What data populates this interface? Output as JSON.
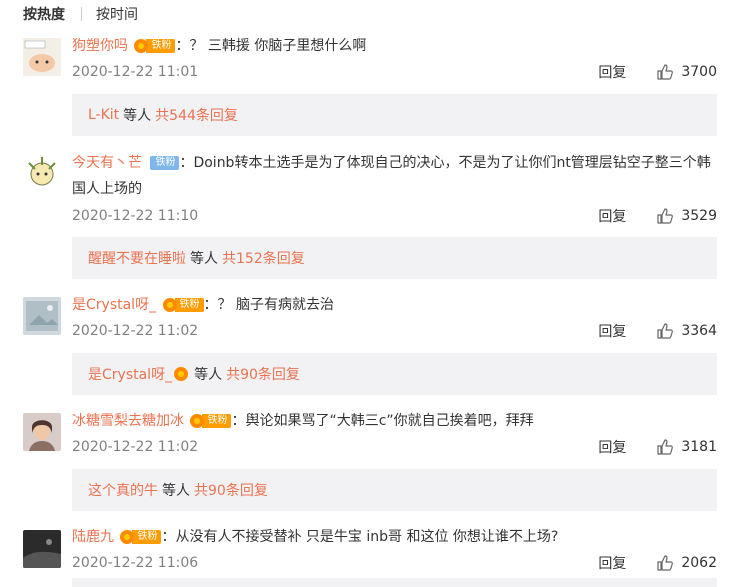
{
  "sort": {
    "hot": "按热度",
    "time": "按时间"
  },
  "reply_label": "回复",
  "etc_label": "等人",
  "comments": [
    {
      "user": "狗塑你吗",
      "badge": "铁粉",
      "text": "：？ 三韩援 你脑子里想什么啊",
      "time": "2020-12-22 11:01",
      "likes": "3700",
      "reply_user": "L-Kit",
      "reply_count": "共544条回复"
    },
    {
      "user": "今天有丶芒",
      "badge": "铁粉",
      "text": "：Doinb转本土选手是为了体现自己的决心，不是为了让你们nt管理层钻空子整三个韩国人上场的",
      "time": "2020-12-22 11:10",
      "likes": "3529",
      "reply_user": "醒醒不要在睡啦",
      "reply_count": "共152条回复"
    },
    {
      "user": "是Crystal呀_",
      "badge": "铁粉",
      "text": "：？ 脑子有病就去治",
      "time": "2020-12-22 11:02",
      "likes": "3364",
      "reply_user": "是Crystal呀_",
      "reply_count": "共90条回复"
    },
    {
      "user": "冰糖雪梨去糖加冰",
      "badge": "铁粉",
      "text": "：舆论如果骂了“大韩三c”你就自己挨着吧，拜拜",
      "time": "2020-12-22 11:02",
      "likes": "3181",
      "reply_user": "这个真的牛",
      "reply_count": "共90条回复"
    },
    {
      "user": "陆鹿九",
      "badge": "铁粉",
      "text": "：从没有人不接受替补 只是牛宝 inb哥 和这位 你想让谁不上场?",
      "time": "2020-12-22 11:06",
      "likes": "2062"
    }
  ],
  "colors": {
    "link": "#eb7350",
    "reply_bg": "#f2f2f5",
    "fan_badge": "#ff9c00",
    "fan_badge_blue": "#7fb7ea"
  }
}
